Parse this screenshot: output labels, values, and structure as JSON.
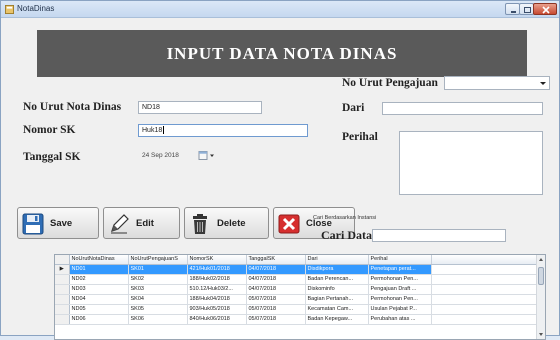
{
  "window": {
    "title": "NotaDinas"
  },
  "banner": {
    "heading": "INPUT DATA NOTA DINAS"
  },
  "form": {
    "no_urut_nota_dinas": {
      "label": "No Urut Nota Dinas",
      "value": "ND18"
    },
    "nomor_sk": {
      "label": "Nomor SK",
      "value": "Huk18"
    },
    "tanggal_sk": {
      "label": "Tanggal SK",
      "value": "24  Sep  2018"
    },
    "no_urut_pengajuan": {
      "label": "No Urut Pengajuan",
      "value": ""
    },
    "dari": {
      "label": "Dari",
      "value": ""
    },
    "perihal": {
      "label": "Perihal",
      "value": ""
    }
  },
  "buttons": {
    "save": {
      "label": "Save",
      "icon": "floppy-disk-icon"
    },
    "edit": {
      "label": "Edit",
      "icon": "pencil-icon"
    },
    "delete": {
      "label": "Delete",
      "icon": "trash-bin-icon"
    },
    "close": {
      "label": "Close",
      "icon": "red-x-icon"
    }
  },
  "search": {
    "group_label": "Cari Berdasarkan Instansi",
    "caption": "Cari Data",
    "value": ""
  },
  "grid": {
    "columns": [
      "NoUrutNotaDinas",
      "NoUrutPengajuanS",
      "NomorSK",
      "TanggalSK",
      "Dari",
      "Perihal"
    ],
    "rows": [
      [
        "ND01",
        "SK01",
        "421/Huk01/2018",
        "04/07/2018",
        "Disdikpora",
        "Penetapan perat..."
      ],
      [
        "ND02",
        "SK02",
        "188/Huk02/2018",
        "04/07/2018",
        "Badan Perencan...",
        "Permohonan Pen..."
      ],
      [
        "ND03",
        "SK03",
        "510.12/Huk03/2...",
        "04/07/2018",
        "Diskominfo",
        "Pengajuan Draft ..."
      ],
      [
        "ND04",
        "SK04",
        "188/Huk04/2018",
        "05/07/2018",
        "Bagian Pertanah...",
        "Permohonan Pen..."
      ],
      [
        "ND05",
        "SK05",
        "903/Huk05/2018",
        "05/07/2018",
        "Kecamatan Cam...",
        "Usulan Pejabat P..."
      ],
      [
        "ND06",
        "SK06",
        "840/Huk06/2018",
        "05/07/2018",
        "Badan Kepegaw...",
        "Perubahan atas ..."
      ]
    ],
    "selected_row": 0,
    "selected_marker": "▶"
  },
  "colors": {
    "banner": "#5a5a5a",
    "selection": "#3399ff",
    "close_red": "#d62f2f",
    "save_blue": "#2f6db5"
  }
}
